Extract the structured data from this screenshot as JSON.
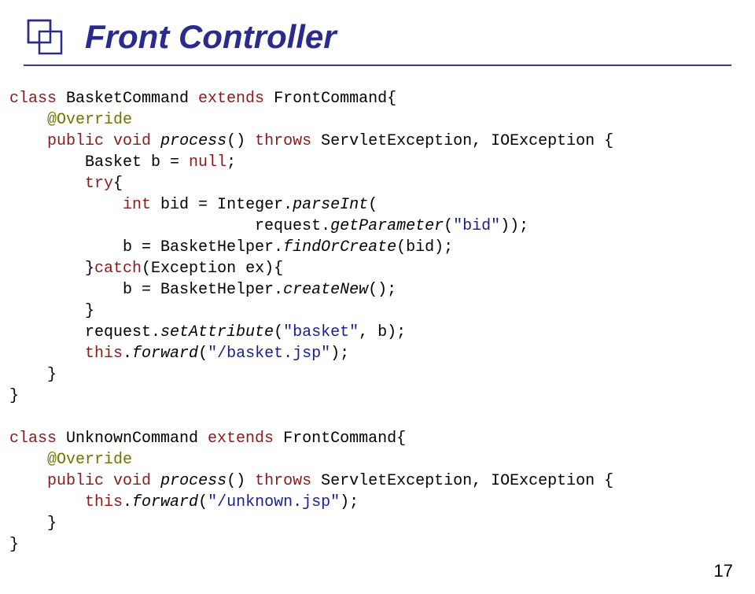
{
  "title": "Front Controller",
  "code": {
    "l1a": "class",
    "l1b": " BasketCommand ",
    "l1c": "extends",
    "l1d": " FrontCommand{",
    "l2a": "    @Override",
    "l3a": "    ",
    "l3b": "public void",
    "l3c": " ",
    "l3d": "process",
    "l3e": "() ",
    "l3f": "throws",
    "l3g": " ServletException, IOException {",
    "l4": "        Basket b = ",
    "l4b": "null",
    "l4c": ";",
    "l5a": "        ",
    "l5b": "try",
    "l5c": "{",
    "l6a": "            ",
    "l6b": "int",
    "l6c": " bid = Integer.",
    "l6d": "parseInt",
    "l6e": "(",
    "l7a": "                          request.",
    "l7b": "getParameter",
    "l7c": "(",
    "l7d": "\"bid\"",
    "l7e": "));",
    "l8a": "            b = BasketHelper.",
    "l8b": "findOrCreate",
    "l8c": "(bid);",
    "l9a": "        }",
    "l9b": "catch",
    "l9c": "(Exception ex){",
    "l10a": "            b = BasketHelper.",
    "l10b": "createNew",
    "l10c": "();",
    "l11": "        }",
    "l12a": "        request.",
    "l12b": "setAttribute",
    "l12c": "(",
    "l12d": "\"basket\"",
    "l12e": ", b);",
    "l13a": "        ",
    "l13b": "this",
    "l13c": ".",
    "l13d": "forward",
    "l13e": "(",
    "l13f": "\"/basket.jsp\"",
    "l13g": ");",
    "l14": "    }",
    "l15": "}",
    "l16": " ",
    "l17a": "class",
    "l17b": " UnknownCommand ",
    "l17c": "extends",
    "l17d": " FrontCommand{",
    "l18": "    @Override",
    "l19a": "    ",
    "l19b": "public void",
    "l19c": " ",
    "l19d": "process",
    "l19e": "() ",
    "l19f": "throws",
    "l19g": " ServletException, IOException {",
    "l20a": "        ",
    "l20b": "this",
    "l20c": ".",
    "l20d": "forward",
    "l20e": "(",
    "l20f": "\"/unknown.jsp\"",
    "l20g": ");",
    "l21": "    }",
    "l22": "}"
  },
  "pageNumber": "17"
}
